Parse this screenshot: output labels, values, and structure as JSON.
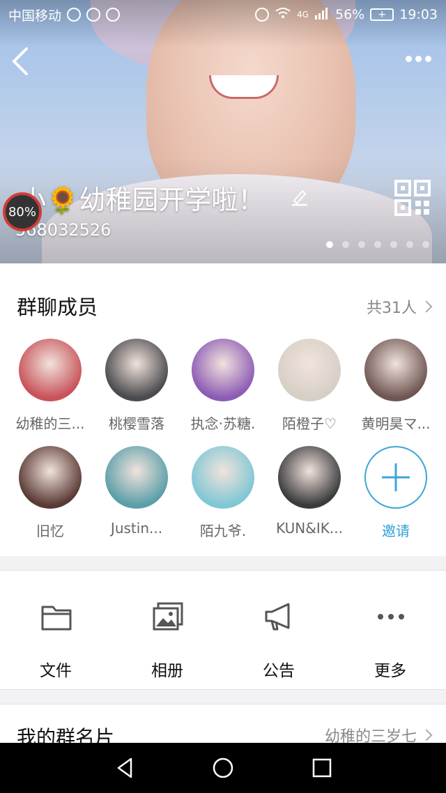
{
  "status_bar": {
    "carrier": "中国移动",
    "network": "4G",
    "battery_percent": "56%",
    "time": "19:03"
  },
  "hero": {
    "group_name": "小🌻幼稚园开学啦！",
    "group_number": "568032526",
    "progress_badge": "80%",
    "carousel_pages": 7,
    "carousel_active_index": 0
  },
  "members": {
    "title": "群聊成员",
    "count_label": "共31人",
    "items": [
      {
        "name": "幼稚的三...",
        "color": "#c8535a"
      },
      {
        "name": "桃樱雪落",
        "color": "#4b4a4e"
      },
      {
        "name": "执念·苏糖.",
        "color": "#8d5bb5"
      },
      {
        "name": "陌橙子♡",
        "color": "#d6cfc6"
      },
      {
        "name": "黄明昊マ...",
        "color": "#6f5653"
      },
      {
        "name": "旧忆",
        "color": "#5a3a34"
      },
      {
        "name": "Justin...",
        "color": "#5a9fa8"
      },
      {
        "name": "陌九爷.",
        "color": "#7fc7d4"
      },
      {
        "name": "KUN&IK...",
        "color": "#3b3b3d"
      }
    ],
    "invite_label": "邀请"
  },
  "actions": [
    {
      "label": "文件",
      "icon": "folder-icon"
    },
    {
      "label": "相册",
      "icon": "album-icon"
    },
    {
      "label": "公告",
      "icon": "announcement-icon"
    },
    {
      "label": "更多",
      "icon": "more-icon"
    }
  ],
  "group_card": {
    "title": "我的群名片",
    "value": "幼稚的三岁七"
  },
  "colors": {
    "accent": "#3ca6d8",
    "badge_ring": "#d23b36"
  }
}
